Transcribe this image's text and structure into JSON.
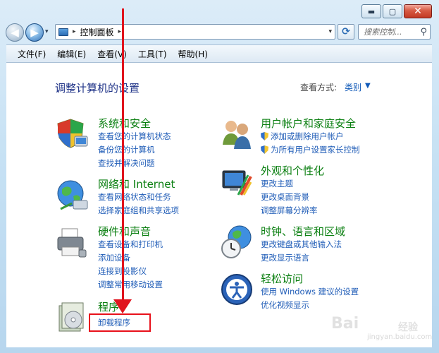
{
  "window": {
    "caption_buttons": {
      "minimize": "▬",
      "maximize": "▢",
      "close": "✕"
    }
  },
  "nav": {
    "back_glyph": "◀",
    "forward_glyph": "▶",
    "recent_glyph": "▾",
    "address": {
      "separator": "▸",
      "location": "控制面板",
      "trail_separator": "▸",
      "dropdown": "▾"
    },
    "refresh_glyph": "⟳",
    "search": {
      "placeholder": "搜索控制...",
      "icon": "magnifier-icon",
      "icon_glyph": "⚲"
    }
  },
  "menubar": {
    "items": [
      "文件(F)",
      "编辑(E)",
      "查看(V)",
      "工具(T)",
      "帮助(H)"
    ]
  },
  "header": {
    "title": "调整计算机的设置",
    "view_by_label": "查看方式:",
    "view_by_value": "类别",
    "view_by_arrow": "▼"
  },
  "categories": {
    "system": {
      "title": "系统和安全",
      "icon": "shield-computer-icon",
      "links": [
        "查看您的计算机状态",
        "备份您的计算机",
        "查找并解决问题"
      ]
    },
    "network": {
      "title": "网络和 Internet",
      "icon": "globe-network-icon",
      "links": [
        "查看网络状态和任务",
        "选择家庭组和共享选项"
      ]
    },
    "hardware": {
      "title": "硬件和声音",
      "icon": "printer-icon",
      "links": [
        "查看设备和打印机",
        "添加设备",
        "连接到投影仪",
        "调整常用移动设置"
      ]
    },
    "programs": {
      "title": "程序",
      "icon": "programs-icon",
      "links": [
        "卸载程序"
      ]
    },
    "accounts": {
      "title": "用户帐户和家庭安全",
      "icon": "users-icon",
      "links": [
        "添加或删除用户帐户",
        "为所有用户设置家长控制"
      ]
    },
    "appearance": {
      "title": "外观和个性化",
      "icon": "monitor-brush-icon",
      "links": [
        "更改主题",
        "更改桌面背景",
        "调整屏幕分辨率"
      ]
    },
    "clock": {
      "title": "时钟、语言和区域",
      "icon": "globe-clock-icon",
      "links": [
        "更改键盘或其他输入法",
        "更改显示语言"
      ]
    },
    "ease": {
      "title": "轻松访问",
      "icon": "ease-of-access-icon",
      "links": [
        "使用 Windows 建议的设置",
        "优化视频显示"
      ]
    }
  },
  "watermark": {
    "brand": "Bai",
    "sub": "经验",
    "url": "jingyan.baidu.com"
  },
  "colors": {
    "title": "#1e3287",
    "category": "#0a7f10",
    "link": "#1f5cb7",
    "annotation": "#e0141e"
  }
}
